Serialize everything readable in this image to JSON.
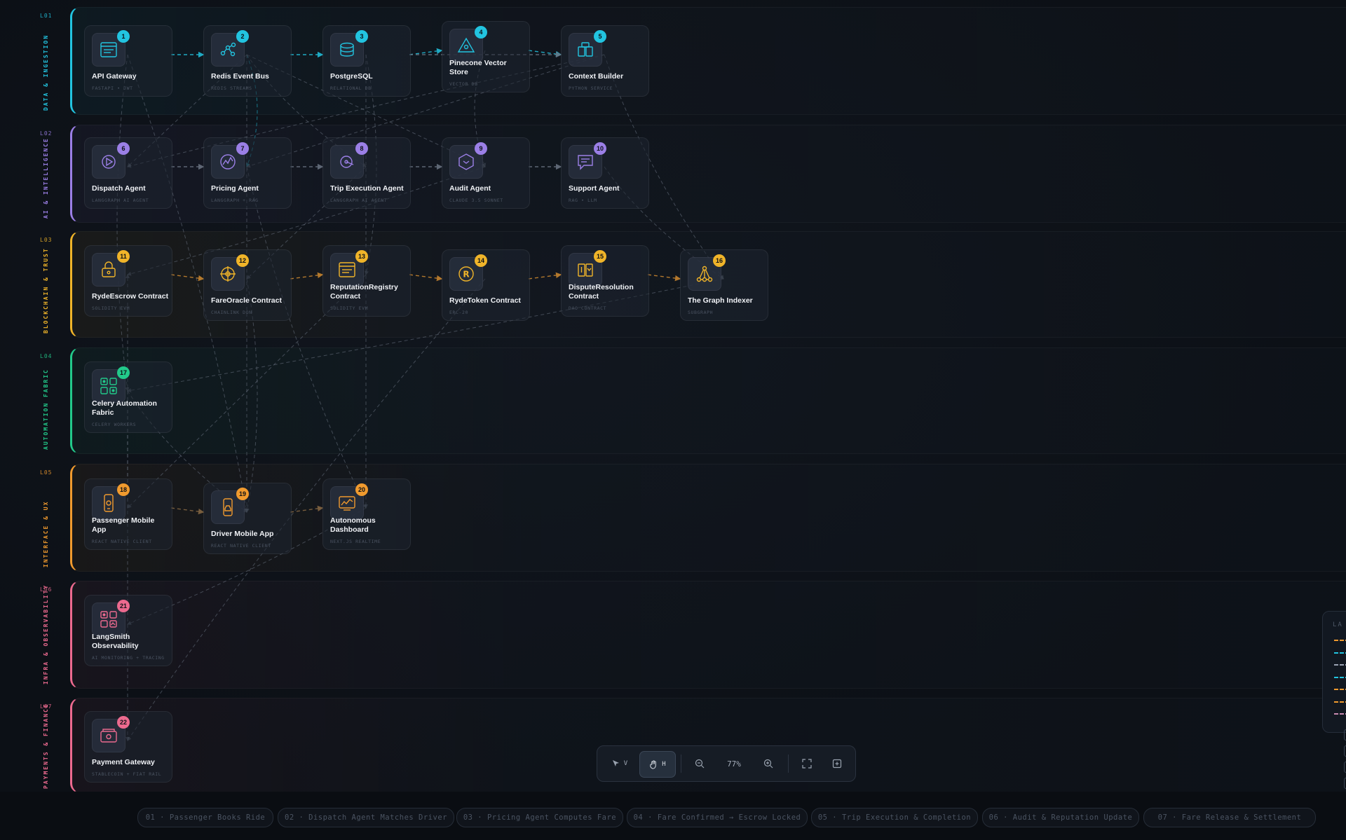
{
  "layers": [
    {
      "code": "L01",
      "name": "DATA & INGESTION",
      "color": "#22c4e0"
    },
    {
      "code": "L02",
      "name": "AI & INTELLIGENCE",
      "color": "#9b7fe6"
    },
    {
      "code": "L03",
      "name": "BLOCKCHAIN & TRUST",
      "color": "#f0b429"
    },
    {
      "code": "L04",
      "name": "AUTOMATION FABRIC",
      "color": "#22c98a"
    },
    {
      "code": "L05",
      "name": "INTERFACE & UX",
      "color": "#f09a2e"
    },
    {
      "code": "L06",
      "name": "INFRA & OBSERVABILITY",
      "color": "#ec6a8f"
    },
    {
      "code": "L07",
      "name": "PAYMENTS & FINANCE",
      "color": "#ec6a8f"
    }
  ],
  "nodes": [
    {
      "num": "1",
      "title": "API Gateway",
      "sub": "FASTAPI • JWT",
      "icon": "server-icon",
      "layer": 0
    },
    {
      "num": "2",
      "title": "Redis Event Bus",
      "sub": "REDIS STREAMS",
      "icon": "network-icon",
      "layer": 0
    },
    {
      "num": "3",
      "title": "PostgreSQL",
      "sub": "RELATIONAL DB",
      "icon": "database-icon",
      "layer": 0
    },
    {
      "num": "4",
      "title": "Pinecone Vector Store",
      "sub": "VECTOR DB",
      "icon": "triangle-icon",
      "layer": 0
    },
    {
      "num": "5",
      "title": "Context Builder",
      "sub": "PYTHON SERVICE",
      "icon": "blocks-icon",
      "layer": 0
    },
    {
      "num": "6",
      "title": "Dispatch Agent",
      "sub": "LANGGRAPH AI AGENT",
      "icon": "play-icon",
      "layer": 1
    },
    {
      "num": "7",
      "title": "Pricing Agent",
      "sub": "LANGGRAPH + RAG",
      "icon": "chart-line-icon",
      "layer": 1
    },
    {
      "num": "8",
      "title": "Trip Execution Agent",
      "sub": "LANGGRAPH AI AGENT",
      "icon": "route-icon",
      "layer": 1
    },
    {
      "num": "9",
      "title": "Audit Agent",
      "sub": "CLAUDE 3.5 SONNET",
      "icon": "hexagon-icon",
      "layer": 1
    },
    {
      "num": "10",
      "title": "Support Agent",
      "sub": "RAG • LLM",
      "icon": "chat-icon",
      "layer": 1
    },
    {
      "num": "11",
      "title": "RydeEscrow Contract",
      "sub": "SOLIDITY EVM",
      "icon": "lock-icon",
      "layer": 2
    },
    {
      "num": "12",
      "title": "FareOracle Contract",
      "sub": "CHAINLINK DON",
      "icon": "crosshair-icon",
      "layer": 2
    },
    {
      "num": "13",
      "title": "ReputationRegistry Contract",
      "sub": "SOLIDITY EVM",
      "icon": "registry-icon",
      "layer": 2
    },
    {
      "num": "14",
      "title": "RydeToken Contract",
      "sub": "ERC-20",
      "icon": "token-icon",
      "layer": 2
    },
    {
      "num": "15",
      "title": "DisputeResolution Contract",
      "sub": "DAO CONTRACT",
      "icon": "scales-icon",
      "layer": 2
    },
    {
      "num": "16",
      "title": "The Graph Indexer",
      "sub": "SUBGRAPH",
      "icon": "graph-icon",
      "layer": 2
    },
    {
      "num": "17",
      "title": "Celery Automation Fabric",
      "sub": "CELERY WORKERS",
      "icon": "grid-icon",
      "layer": 3
    },
    {
      "num": "18",
      "title": "Passenger Mobile App",
      "sub": "REACT NATIVE CLIENT",
      "icon": "phone-icon",
      "layer": 4
    },
    {
      "num": "19",
      "title": "Driver Mobile App",
      "sub": "REACT NATIVE CLIENT",
      "icon": "phone-car-icon",
      "layer": 4
    },
    {
      "num": "20",
      "title": "Autonomous Dashboard",
      "sub": "NEXT.JS REALTIME",
      "icon": "dashboard-icon",
      "layer": 4
    },
    {
      "num": "21",
      "title": "LangSmith Observability",
      "sub": "AI MONITORING + TRACING",
      "icon": "monitor-grid-icon",
      "layer": 5
    },
    {
      "num": "22",
      "title": "Payment Gateway",
      "sub": "STABLECOIN + FIAT RAIL",
      "icon": "wallet-icon",
      "layer": 6
    }
  ],
  "toolbar": {
    "select_key": "V",
    "pan_key": "H",
    "zoom_level": "77%"
  },
  "steps": [
    "01 · Passenger Books Ride",
    "02 · Dispatch Agent Matches Driver",
    "03 · Pricing Agent Computes Fare",
    "04 · Fare Confirmed → Escrow Locked",
    "05 · Trip Execution & Completion",
    "06 · Audit & Reputation Update",
    "07 · Fare Release & Settlement"
  ],
  "legend": {
    "title": "LA",
    "line_colors": [
      "#f09a2e",
      "#22c4e0",
      "#9aa3b2",
      "#22c4e0",
      "#f09a2e",
      "#f09a2e",
      "#c88ab0"
    ]
  }
}
